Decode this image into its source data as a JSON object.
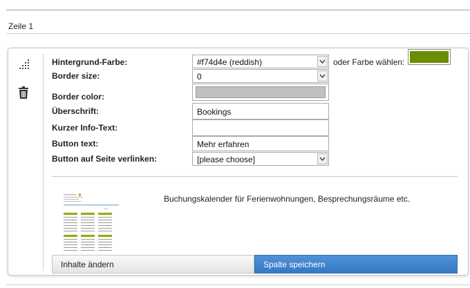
{
  "row": {
    "title": "Zeile 1"
  },
  "sidebar": {
    "icons": [
      "signal-bars-icon",
      "trash-icon"
    ]
  },
  "form": {
    "background_color": {
      "label": "Hintergrund-Farbe:",
      "value": "#f74d4e (reddish)",
      "or_label": "oder Farbe wählen:",
      "picker_color": "#6b8e00"
    },
    "border_size": {
      "label": "Border size:",
      "value": "0"
    },
    "border_color": {
      "label": "Border color:",
      "swatch_color": "#c0c0c0"
    },
    "heading": {
      "label": "Überschrift:",
      "value": "Bookings"
    },
    "short_info": {
      "label": "Kurzer Info-Text:",
      "value": ""
    },
    "button_text": {
      "label": "Button text:",
      "value": "Mehr erfahren"
    },
    "button_link": {
      "label": "Button auf Seite verlinken:",
      "value": "[please choose]"
    }
  },
  "preview": {
    "description": "Buchungskalender für Ferienwohnungen, Besprechungsräume etc."
  },
  "actions": {
    "edit_label": "Inhalte ändern",
    "save_label": "Spalte speichern"
  },
  "colors": {
    "accent": "#3479c4",
    "calendar_green": "#8cb000"
  }
}
